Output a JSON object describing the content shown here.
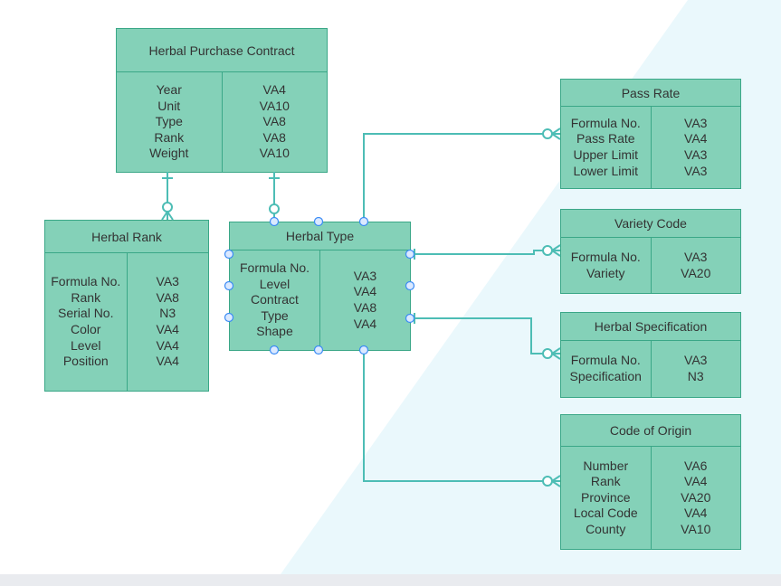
{
  "diagram": {
    "entities": [
      {
        "id": "herbal-purchase-contract",
        "title": "Herbal Purchase Contract",
        "attributes": [
          "Year",
          "Unit",
          "Type",
          "Rank",
          "Weight"
        ],
        "types": [
          "VA4",
          "VA10",
          "VA8",
          "VA8",
          "VA10"
        ]
      },
      {
        "id": "herbal-rank",
        "title": "Herbal Rank",
        "attributes": [
          "Formula No.",
          "Rank",
          "Serial No.",
          "Color",
          "Level",
          "Position"
        ],
        "types": [
          "VA3",
          "VA8",
          "N3",
          "VA4",
          "VA4",
          "VA4"
        ]
      },
      {
        "id": "herbal-type",
        "title": "Herbal Type",
        "attributes": [
          "Formula No.",
          "Level",
          "Contract",
          "Type",
          "Shape"
        ],
        "types": [
          "VA3",
          "VA4",
          "VA8",
          "VA4"
        ]
      },
      {
        "id": "pass-rate",
        "title": "Pass Rate",
        "attributes": [
          "Formula No.",
          "Pass Rate",
          "Upper Limit",
          "Lower Limit"
        ],
        "types": [
          "VA3",
          "VA4",
          "VA3",
          "VA3"
        ]
      },
      {
        "id": "variety-code",
        "title": "Variety Code",
        "attributes": [
          "Formula No.",
          "Variety"
        ],
        "types": [
          "VA3",
          "VA20"
        ]
      },
      {
        "id": "herbal-specification",
        "title": "Herbal Specification",
        "attributes": [
          "Formula No.",
          "Specification"
        ],
        "types": [
          "VA3",
          "N3"
        ]
      },
      {
        "id": "code-of-origin",
        "title": "Code of Origin",
        "attributes": [
          "Number",
          "Rank",
          "Province",
          "Local Code",
          "County"
        ],
        "types": [
          "VA6",
          "VA4",
          "VA20",
          "VA4",
          "VA10"
        ]
      }
    ],
    "relationships": [
      {
        "from": "herbal-purchase-contract",
        "to": "herbal-rank",
        "from_end": "one",
        "to_end": "zero-or-many"
      },
      {
        "from": "herbal-purchase-contract",
        "to": "herbal-type",
        "from_end": "one",
        "to_end": "zero-or-one"
      },
      {
        "from": "herbal-type",
        "to": "pass-rate",
        "from_end": "one",
        "to_end": "zero-or-many"
      },
      {
        "from": "herbal-type",
        "to": "variety-code",
        "from_end": "one",
        "to_end": "zero-or-many"
      },
      {
        "from": "herbal-type",
        "to": "herbal-specification",
        "from_end": "one",
        "to_end": "zero-or-many"
      },
      {
        "from": "herbal-type",
        "to": "code-of-origin",
        "from_end": "one",
        "to_end": "zero-or-many"
      }
    ],
    "selected": "herbal-type",
    "colors": {
      "entity_fill": "#84d1b8",
      "entity_border": "#3aa787",
      "connector": "#4dbdb5",
      "handle": "#3b8bf5",
      "background_accent": "#eaf8fc"
    }
  }
}
